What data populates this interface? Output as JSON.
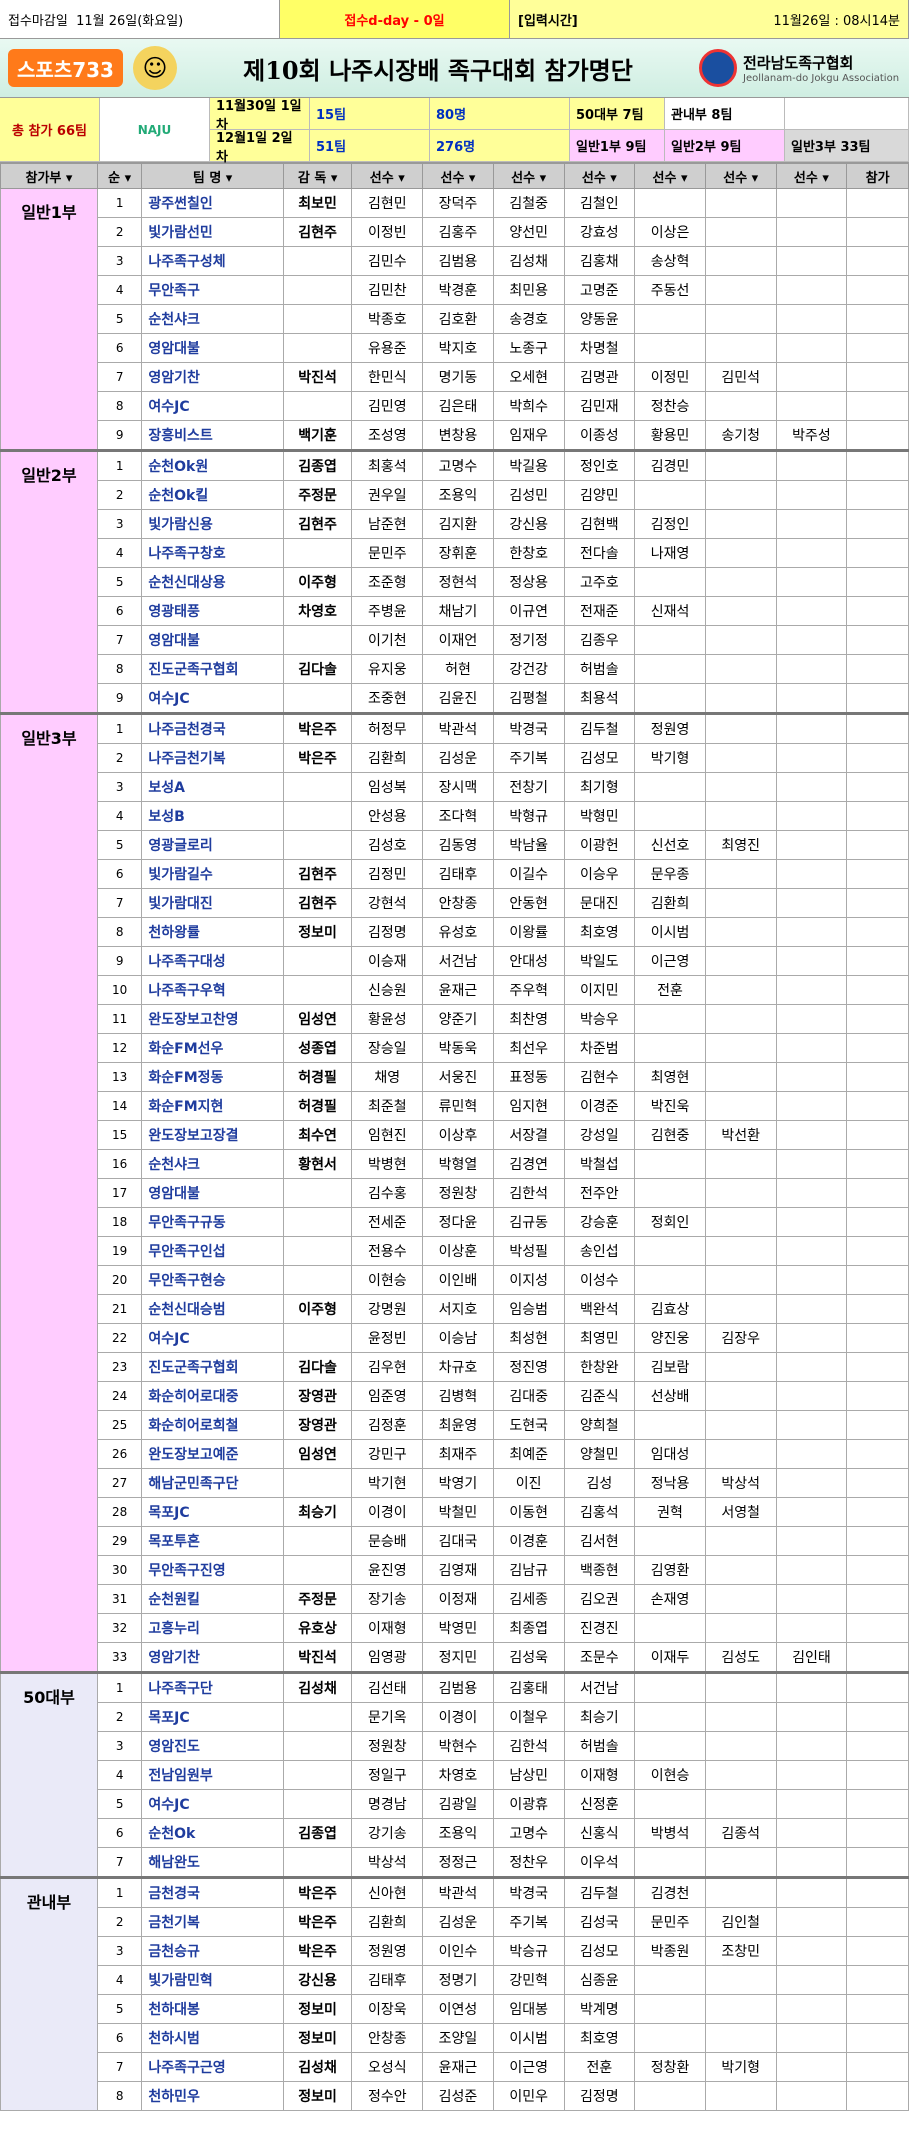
{
  "header": {
    "deadline_label": "접수마감일",
    "deadline_date": "11월 26일(화요일)",
    "dday": "접수d-day -   0일",
    "input_label": "[입력시간]",
    "input_time": "11월26일 : 08시14분"
  },
  "banner": {
    "logo": "스포츠733",
    "title": "제10회 나주시장배 족구대회 참가명단",
    "assoc_name": "전라남도족구협회",
    "assoc_sub": "Jeollanam-do Jokgu Association"
  },
  "summary": {
    "total": "총 참가  66팀",
    "day1": "11월30일 1일차",
    "day1_teams": "15팀",
    "day1_players": "80명",
    "day2": "12월1일 2일차",
    "day2_teams": "51팀",
    "day2_players": "276명",
    "c1": "50대부    7팀",
    "c2": "관내부    8팀",
    "c3": "일반1부    9팀",
    "c4": "일반2부    9팀",
    "c5": "일반3부    33팀",
    "naju_logo": "NAJU"
  },
  "columns": [
    "참가부",
    "순",
    "팀 명",
    "감 독",
    "선수",
    "선수",
    "선수",
    "선수",
    "선수",
    "선수",
    "선수",
    "참가"
  ],
  "divisions": [
    {
      "name": "일반1부",
      "rows": [
        [
          "1",
          "광주썬칠인",
          "최보민",
          "김현민",
          "장덕주",
          "김철중",
          "김철인",
          "",
          "",
          ""
        ],
        [
          "2",
          "빛가람선민",
          "김현주",
          "이정빈",
          "김홍주",
          "양선민",
          "강효성",
          "이상은",
          "",
          ""
        ],
        [
          "3",
          "나주족구성체",
          "",
          "김민수",
          "김범용",
          "김성채",
          "김홍채",
          "송상혁",
          "",
          ""
        ],
        [
          "4",
          "무안족구",
          "",
          "김민찬",
          "박경훈",
          "최민용",
          "고명준",
          "주동선",
          "",
          ""
        ],
        [
          "5",
          "순천샤크",
          "",
          "박종호",
          "김호환",
          "송경호",
          "양동윤",
          "",
          "",
          ""
        ],
        [
          "6",
          "영암대불",
          "",
          "유용준",
          "박지호",
          "노종구",
          "차명철",
          "",
          "",
          ""
        ],
        [
          "7",
          "영암기찬",
          "박진석",
          "한민식",
          "명기동",
          "오세현",
          "김명관",
          "이정민",
          "김민석",
          ""
        ],
        [
          "8",
          "여수JC",
          "",
          "김민영",
          "김은태",
          "박희수",
          "김민재",
          "정찬승",
          "",
          ""
        ],
        [
          "9",
          "장흥비스트",
          "백기훈",
          "조성영",
          "변창용",
          "임재우",
          "이종성",
          "황용민",
          "송기청",
          "박주성"
        ]
      ]
    },
    {
      "name": "일반2부",
      "rows": [
        [
          "1",
          "순천Ok원",
          "김종엽",
          "최홍석",
          "고명수",
          "박길용",
          "정인호",
          "김경민",
          "",
          ""
        ],
        [
          "2",
          "순천Ok킬",
          "주정문",
          "권우일",
          "조용익",
          "김성민",
          "김양민",
          "",
          "",
          ""
        ],
        [
          "3",
          "빛가람신용",
          "김현주",
          "남준현",
          "김지환",
          "강신용",
          "김현백",
          "김정인",
          "",
          ""
        ],
        [
          "4",
          "나주족구창호",
          "",
          "문민주",
          "장휘훈",
          "한창호",
          "전다솔",
          "나재영",
          "",
          ""
        ],
        [
          "5",
          "순천신대상용",
          "이주형",
          "조준형",
          "정현석",
          "정상용",
          "고주호",
          "",
          "",
          ""
        ],
        [
          "6",
          "영광태풍",
          "차영호",
          "주병윤",
          "채남기",
          "이규연",
          "전재준",
          "신재석",
          "",
          ""
        ],
        [
          "7",
          "영암대불",
          "",
          "이기천",
          "이재언",
          "정기정",
          "김종우",
          "",
          "",
          ""
        ],
        [
          "8",
          "진도군족구협회",
          "김다솔",
          "유지웅",
          "허현",
          "강건강",
          "허범솔",
          "",
          "",
          ""
        ],
        [
          "9",
          "여수JC",
          "",
          "조중현",
          "김윤진",
          "김평철",
          "최용석",
          "",
          "",
          ""
        ]
      ]
    },
    {
      "name": "일반3부",
      "rows": [
        [
          "1",
          "나주금천경국",
          "박은주",
          "허정무",
          "박관석",
          "박경국",
          "김두철",
          "정원영",
          "",
          ""
        ],
        [
          "2",
          "나주금천기복",
          "박은주",
          "김환희",
          "김성운",
          "주기복",
          "김성모",
          "박기형",
          "",
          ""
        ],
        [
          "3",
          "보성A",
          "",
          "임성복",
          "장시맥",
          "전창기",
          "최기형",
          "",
          "",
          ""
        ],
        [
          "4",
          "보성B",
          "",
          "안성용",
          "조다혁",
          "박형규",
          "박형민",
          "",
          "",
          ""
        ],
        [
          "5",
          "영광글로리",
          "",
          "김성호",
          "김동영",
          "박남율",
          "이광헌",
          "신선호",
          "최영진",
          ""
        ],
        [
          "6",
          "빛가람길수",
          "김현주",
          "김정민",
          "김태후",
          "이길수",
          "이승우",
          "문우종",
          "",
          ""
        ],
        [
          "7",
          "빛가람대진",
          "김현주",
          "강현석",
          "안창종",
          "안동현",
          "문대진",
          "김환희",
          "",
          ""
        ],
        [
          "8",
          "천하왕률",
          "정보미",
          "김정명",
          "유성호",
          "이왕률",
          "최호영",
          "이시범",
          "",
          ""
        ],
        [
          "9",
          "나주족구대성",
          "",
          "이승재",
          "서건남",
          "안대성",
          "박일도",
          "이근영",
          "",
          ""
        ],
        [
          "10",
          "나주족구우혁",
          "",
          "신승원",
          "윤재근",
          "주우혁",
          "이지민",
          "전훈",
          "",
          ""
        ],
        [
          "11",
          "완도장보고찬영",
          "임성연",
          "황윤성",
          "양준기",
          "최찬영",
          "박승우",
          "",
          "",
          ""
        ],
        [
          "12",
          "화순FM선우",
          "성종엽",
          "장승일",
          "박동욱",
          "최선우",
          "차준범",
          "",
          "",
          ""
        ],
        [
          "13",
          "화순FM정동",
          "허경필",
          "채영",
          "서웅진",
          "표정동",
          "김현수",
          "최영현",
          "",
          ""
        ],
        [
          "14",
          "화순FM지현",
          "허경필",
          "최준철",
          "류민혁",
          "임지현",
          "이경준",
          "박진욱",
          "",
          ""
        ],
        [
          "15",
          "완도장보고장결",
          "최수연",
          "임현진",
          "이상후",
          "서장결",
          "강성일",
          "김현중",
          "박선환",
          ""
        ],
        [
          "16",
          "순천샤크",
          "황현서",
          "박병현",
          "박형열",
          "김경연",
          "박철섭",
          "",
          "",
          ""
        ],
        [
          "17",
          "영암대불",
          "",
          "김수홍",
          "정원창",
          "김한석",
          "전주안",
          "",
          "",
          ""
        ],
        [
          "18",
          "무안족구규동",
          "",
          "전세준",
          "정다윤",
          "김규동",
          "강승훈",
          "정회인",
          "",
          ""
        ],
        [
          "19",
          "무안족구인섭",
          "",
          "전용수",
          "이상훈",
          "박성필",
          "송인섭",
          "",
          "",
          ""
        ],
        [
          "20",
          "무안족구현승",
          "",
          "이현승",
          "이인배",
          "이지성",
          "이성수",
          "",
          "",
          ""
        ],
        [
          "21",
          "순천신대승범",
          "이주형",
          "강명원",
          "서지호",
          "임승범",
          "백완석",
          "김효상",
          "",
          ""
        ],
        [
          "22",
          "여수JC",
          "",
          "윤정빈",
          "이승남",
          "최성현",
          "최영민",
          "양진웅",
          "김장우",
          ""
        ],
        [
          "23",
          "진도군족구협회",
          "김다솔",
          "김우현",
          "차규호",
          "정진영",
          "한창완",
          "김보람",
          "",
          ""
        ],
        [
          "24",
          "화순히어로대중",
          "장영관",
          "임준영",
          "김병혁",
          "김대중",
          "김준식",
          "선상배",
          "",
          ""
        ],
        [
          "25",
          "화순히어로희철",
          "장영관",
          "김정훈",
          "최윤영",
          "도현국",
          "양희철",
          "",
          "",
          ""
        ],
        [
          "26",
          "완도장보고예준",
          "임성연",
          "강민구",
          "최재주",
          "최예준",
          "양철민",
          "임대성",
          "",
          ""
        ],
        [
          "27",
          "해남군민족구단",
          "",
          "박기현",
          "박영기",
          "이진",
          "김성",
          "정낙용",
          "박상석",
          ""
        ],
        [
          "28",
          "목포JC",
          "최승기",
          "이경이",
          "박철민",
          "이동현",
          "김홍석",
          "권혁",
          "서영철",
          ""
        ],
        [
          "29",
          "목포투혼",
          "",
          "문승배",
          "김대국",
          "이경훈",
          "김서현",
          "",
          "",
          ""
        ],
        [
          "30",
          "무안족구진영",
          "",
          "윤진영",
          "김영재",
          "김남규",
          "백종현",
          "김영환",
          "",
          ""
        ],
        [
          "31",
          "순천원킬",
          "주정문",
          "장기송",
          "이정재",
          "김세종",
          "김오권",
          "손재영",
          "",
          ""
        ],
        [
          "32",
          "고흥누리",
          "유호상",
          "이재형",
          "박영민",
          "최종엽",
          "진경진",
          "",
          "",
          ""
        ],
        [
          "33",
          "영암기찬",
          "박진석",
          "임영광",
          "정지민",
          "김성욱",
          "조문수",
          "이재두",
          "김성도",
          "김인태"
        ]
      ]
    },
    {
      "name": "50대부",
      "rows": [
        [
          "1",
          "나주족구단",
          "김성채",
          "김선태",
          "김범용",
          "김홍태",
          "서건남",
          "",
          "",
          ""
        ],
        [
          "2",
          "목포JC",
          "",
          "문기옥",
          "이경이",
          "이철우",
          "최승기",
          "",
          "",
          ""
        ],
        [
          "3",
          "영암진도",
          "",
          "정원창",
          "박현수",
          "김한석",
          "허범솔",
          "",
          "",
          ""
        ],
        [
          "4",
          "전남임원부",
          "",
          "정일구",
          "차영호",
          "남상민",
          "이재형",
          "이현승",
          "",
          ""
        ],
        [
          "5",
          "여수JC",
          "",
          "명경남",
          "김광일",
          "이광휴",
          "신정훈",
          "",
          "",
          ""
        ],
        [
          "6",
          "순천Ok",
          "김종엽",
          "강기송",
          "조용익",
          "고명수",
          "신홍식",
          "박병석",
          "김종석",
          ""
        ],
        [
          "7",
          "해남완도",
          "",
          "박상석",
          "정정근",
          "정찬우",
          "이우석",
          "",
          "",
          ""
        ]
      ]
    },
    {
      "name": "관내부",
      "rows": [
        [
          "1",
          "금천경국",
          "박은주",
          "신아현",
          "박관석",
          "박경국",
          "김두철",
          "김경천",
          "",
          ""
        ],
        [
          "2",
          "금천기복",
          "박은주",
          "김환희",
          "김성운",
          "주기복",
          "김성국",
          "문민주",
          "김인철",
          ""
        ],
        [
          "3",
          "금천승규",
          "박은주",
          "정원영",
          "이인수",
          "박승규",
          "김성모",
          "박종원",
          "조창민",
          ""
        ],
        [
          "4",
          "빛가람민혁",
          "강신용",
          "김태후",
          "정명기",
          "강민혁",
          "심종윤",
          "",
          "",
          ""
        ],
        [
          "5",
          "천하대봉",
          "정보미",
          "이장욱",
          "이연성",
          "임대봉",
          "박계명",
          "",
          "",
          ""
        ],
        [
          "6",
          "천하시범",
          "정보미",
          "안창종",
          "조양일",
          "이시범",
          "최호영",
          "",
          "",
          ""
        ],
        [
          "7",
          "나주족구근영",
          "김성채",
          "오성식",
          "윤재근",
          "이근영",
          "전훈",
          "정창환",
          "박기형",
          ""
        ],
        [
          "8",
          "천하민우",
          "정보미",
          "정수안",
          "김성준",
          "이민우",
          "김정명",
          "",
          "",
          ""
        ]
      ]
    }
  ]
}
